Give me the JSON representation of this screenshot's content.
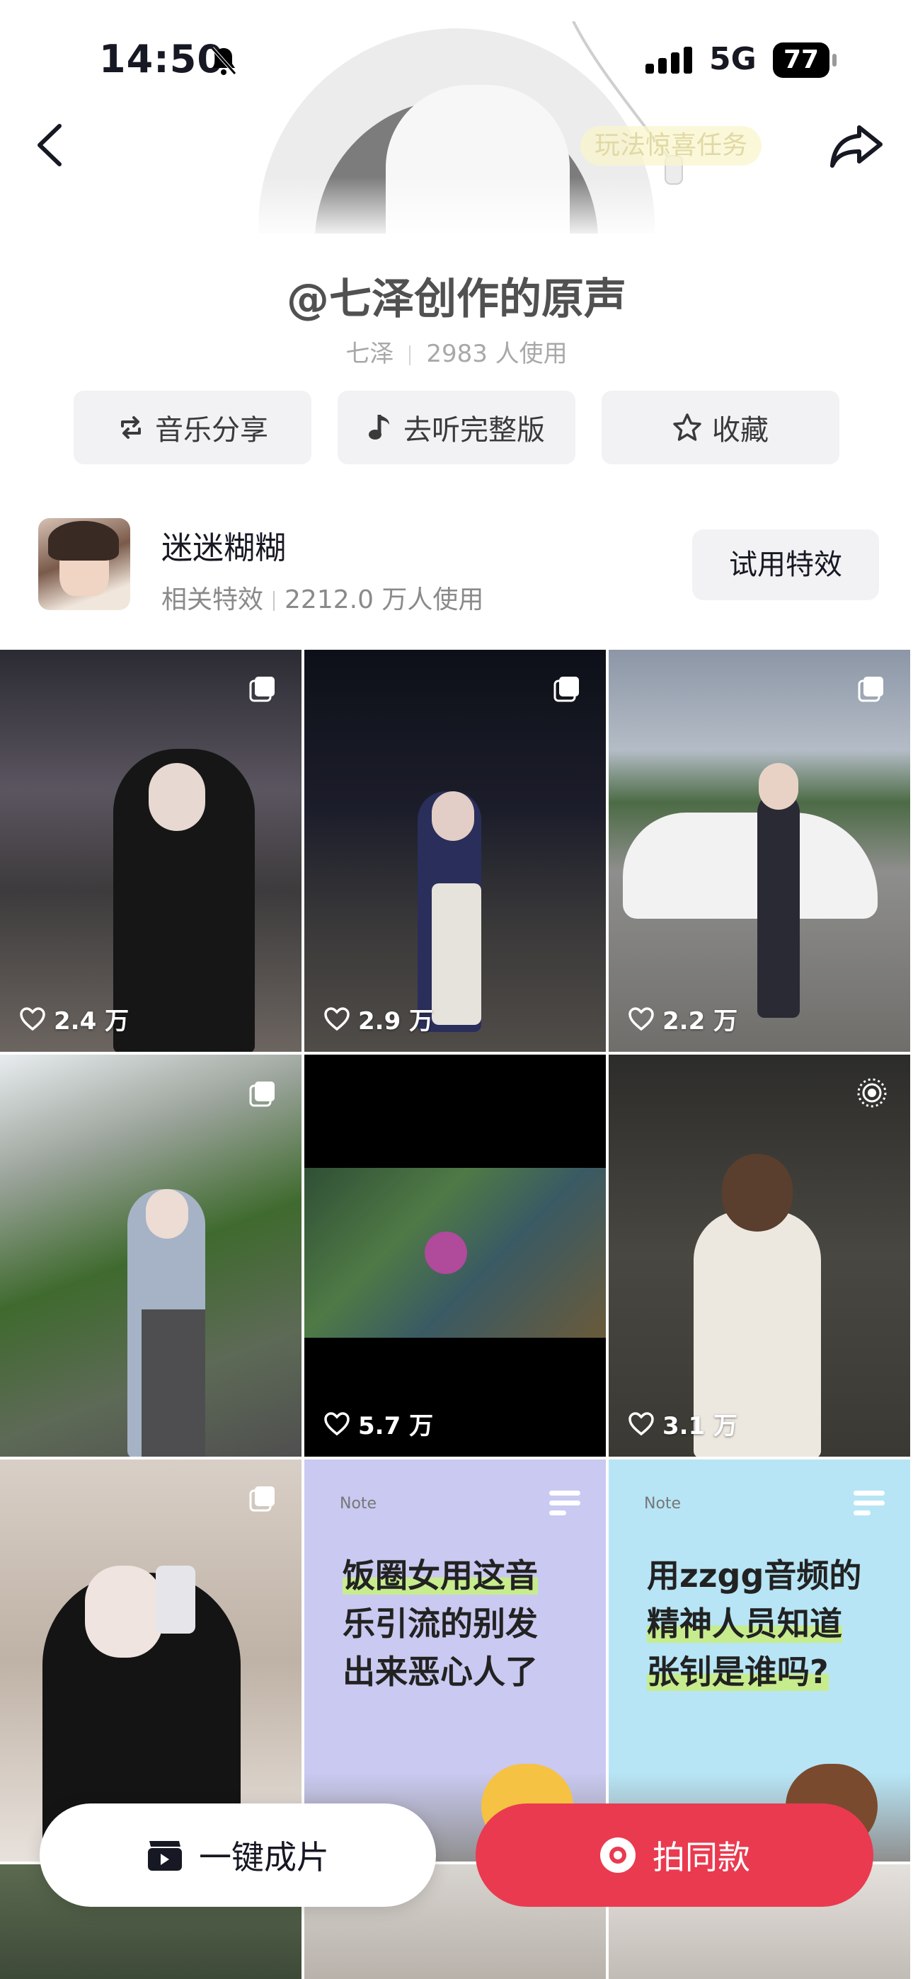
{
  "status_bar": {
    "time": "14:50",
    "network": "5G",
    "battery": "77"
  },
  "header": {
    "promo_tag": "玩法惊喜任务"
  },
  "sound": {
    "title": "@七泽创作的原声",
    "author": "七泽",
    "usage": "2983 人使用"
  },
  "actions": [
    {
      "label": "音乐分享",
      "icon": "repost-icon"
    },
    {
      "label": "去听完整版",
      "icon": "music-note-icon"
    },
    {
      "label": "收藏",
      "icon": "star-icon"
    }
  ],
  "effect": {
    "name": "迷迷糊糊",
    "category": "相关特效",
    "usage": "2212.0 万人使用",
    "button": "试用特效"
  },
  "videos": [
    {
      "likes": "2.4 万",
      "badge": "multi-image-icon"
    },
    {
      "likes": "2.9 万",
      "badge": "multi-image-icon"
    },
    {
      "likes": "2.2 万",
      "badge": "multi-image-icon"
    },
    {
      "likes": "",
      "badge": "multi-image-icon"
    },
    {
      "likes": "5.7 万",
      "badge": ""
    },
    {
      "likes": "3.1 万",
      "badge": "live-photo-icon"
    },
    {
      "likes": "",
      "badge": "multi-image-icon"
    },
    {
      "likes": "",
      "badge": "note-icon",
      "note_label": "Note",
      "note_lines": [
        "饭圈女用这音",
        "乐引流的别发",
        "出来恶心人了"
      ]
    },
    {
      "likes": "",
      "badge": "note-icon",
      "note_label": "Note",
      "note_lines": [
        "用zzgg音频的",
        "精神人员知道",
        "张钊是谁吗?"
      ]
    }
  ],
  "bottom_bar": {
    "left": "一键成片",
    "right": "拍同款"
  },
  "colors": {
    "accent": "#ea3a4f",
    "action_bg": "#f2f2f4",
    "note_purple": "#c9c9f1",
    "note_blue": "#b7e5f5"
  }
}
